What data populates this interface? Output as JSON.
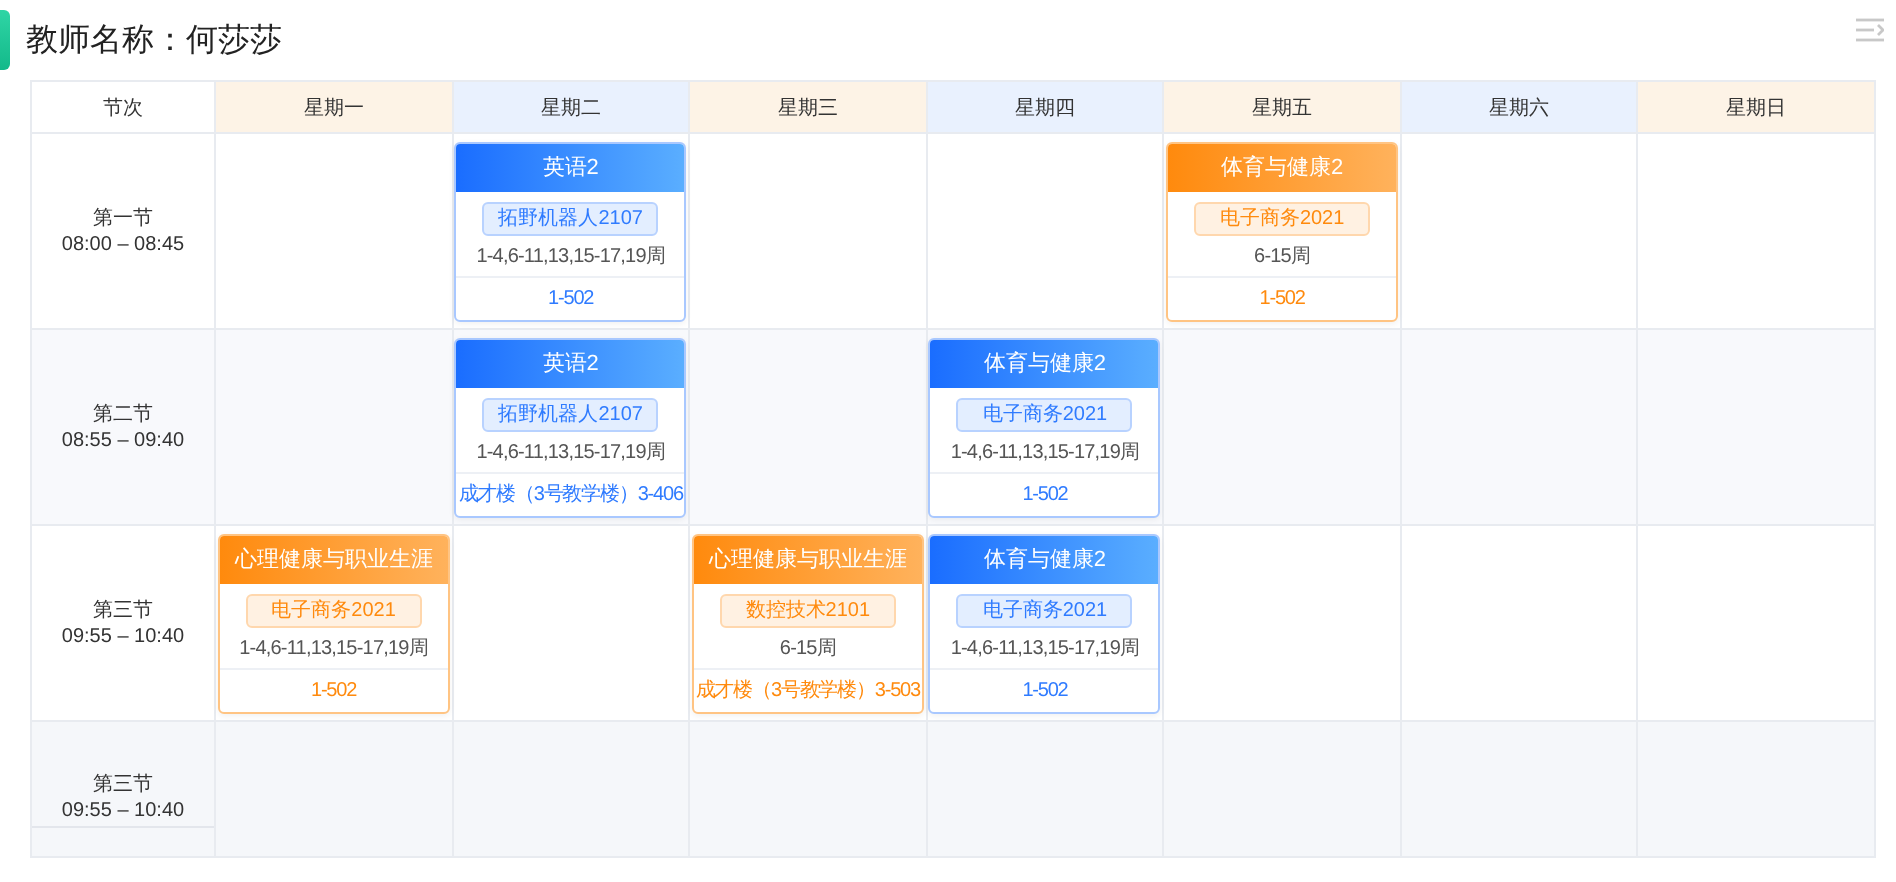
{
  "title": "教师名称：何莎莎",
  "corner_header": "节次",
  "days": [
    {
      "label": "星期一",
      "kind": "warm"
    },
    {
      "label": "星期二",
      "kind": "cool"
    },
    {
      "label": "星期三",
      "kind": "warm"
    },
    {
      "label": "星期四",
      "kind": "cool"
    },
    {
      "label": "星期五",
      "kind": "warm"
    },
    {
      "label": "星期六",
      "kind": "cool"
    },
    {
      "label": "星期日",
      "kind": "warm"
    }
  ],
  "periods": [
    {
      "name": "第一节",
      "time": "08:00 – 08:45",
      "cells": [
        {},
        {
          "kind": "blue",
          "title": "英语2",
          "class": "拓野机器人2107",
          "weeks": "1-4,6-11,13,15-17,19周",
          "room": "1-502"
        },
        {},
        {},
        {
          "kind": "orange",
          "title": "体育与健康2",
          "class": "电子商务2021",
          "weeks": "6-15周",
          "room": "1-502"
        },
        {},
        {}
      ]
    },
    {
      "name": "第二节",
      "time": "08:55 – 09:40",
      "cells": [
        {},
        {
          "kind": "blue",
          "title": "英语2",
          "class": "拓野机器人2107",
          "weeks": "1-4,6-11,13,15-17,19周",
          "room": "成才楼（3号教学楼）3-406"
        },
        {},
        {
          "kind": "blue",
          "title": "体育与健康2",
          "class": "电子商务2021",
          "weeks": "1-4,6-11,13,15-17,19周",
          "room": "1-502"
        },
        {},
        {},
        {}
      ]
    },
    {
      "name": "第三节",
      "time": "09:55 – 10:40",
      "cells": [
        {
          "kind": "orange",
          "title": "心理健康与职业生涯",
          "class": "电子商务2021",
          "weeks": "1-4,6-11,13,15-17,19周",
          "room": "1-502"
        },
        {},
        {
          "kind": "orange",
          "title": "心理健康与职业生涯",
          "class": "数控技术2101",
          "weeks": "6-15周",
          "room": "成才楼（3号教学楼）3-503"
        },
        {
          "kind": "blue",
          "title": "体育与健康2",
          "class": "电子商务2021",
          "weeks": "1-4,6-11,13,15-17,19周",
          "room": "1-502"
        },
        {},
        {},
        {}
      ]
    },
    {
      "name": "第三节",
      "time": "09:55 – 10:40",
      "cells": [
        {},
        {},
        {},
        {},
        {},
        {},
        {}
      ]
    }
  ]
}
